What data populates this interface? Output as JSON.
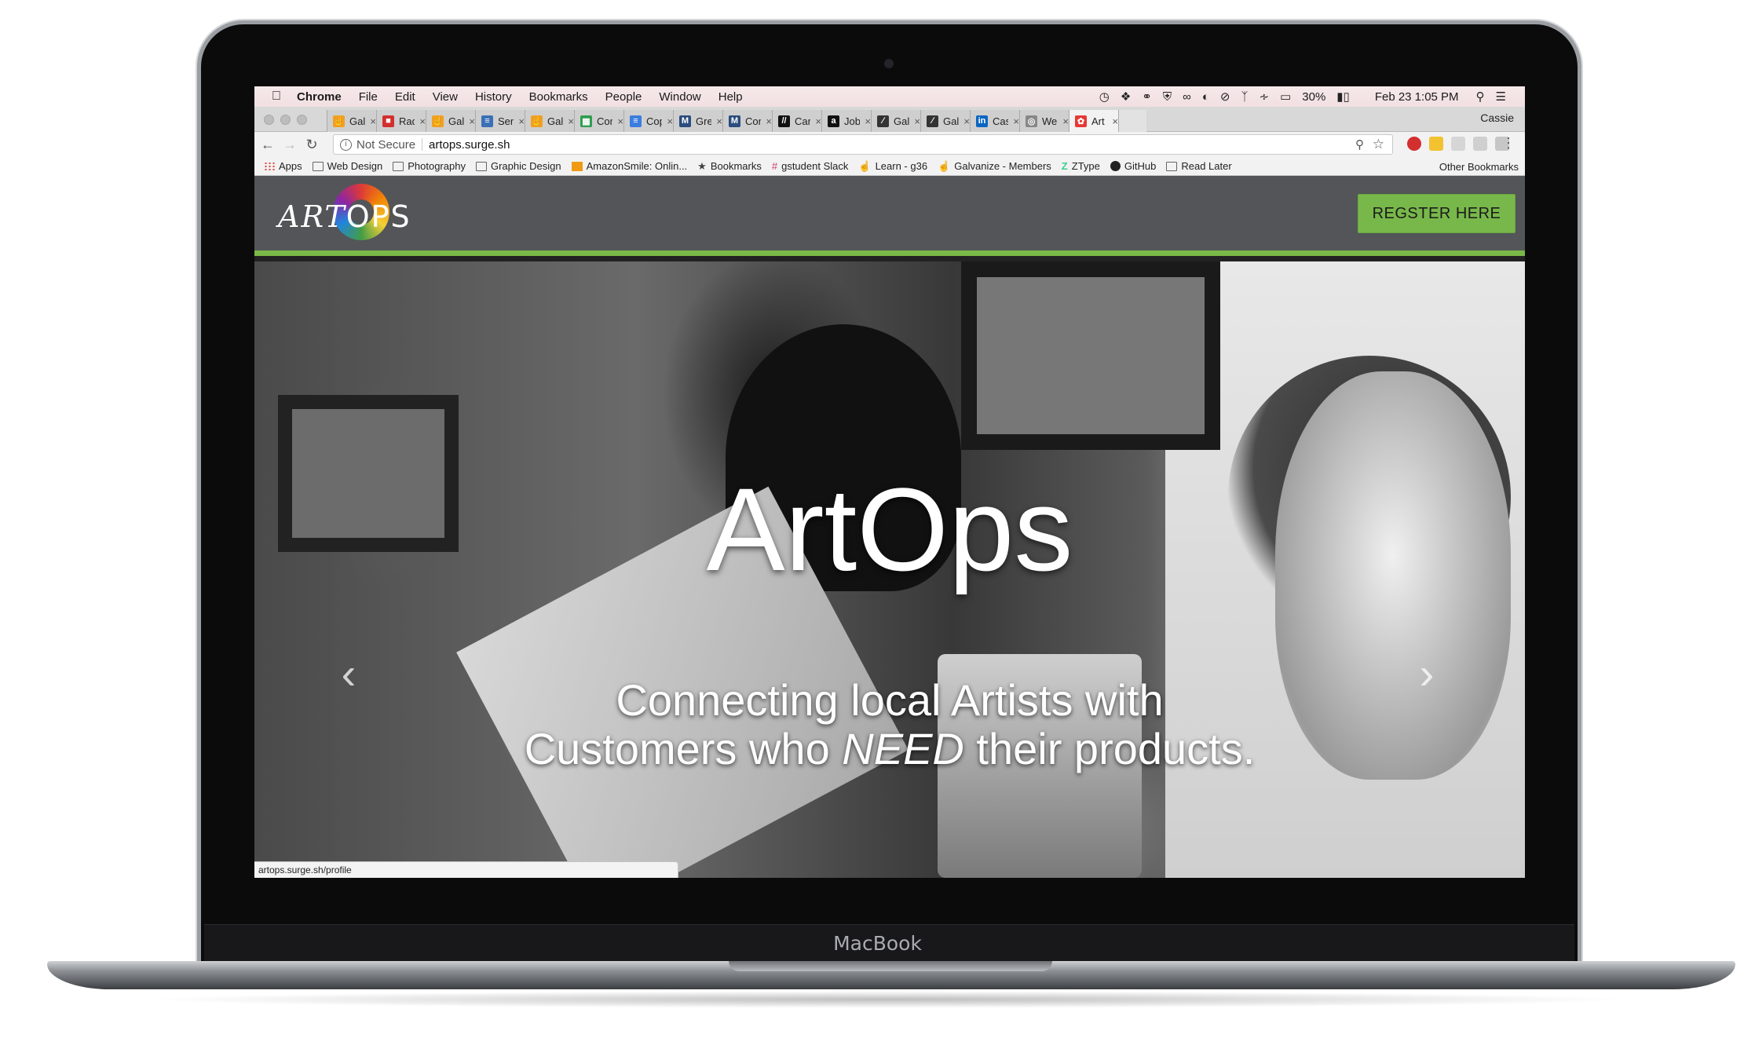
{
  "device": {
    "brand": "MacBook"
  },
  "menubar": {
    "app": "Chrome",
    "items": [
      "File",
      "Edit",
      "View",
      "History",
      "Bookmarks",
      "People",
      "Window",
      "Help"
    ],
    "battery": "30%",
    "datetime": "Feb 23  1:05 PM"
  },
  "tabs": [
    {
      "title": "Galv",
      "icon_color": "#f0a020",
      "icon": "hand-icon"
    },
    {
      "title": "Radi",
      "icon_color": "#d32f2f",
      "icon": "radio-icon"
    },
    {
      "title": "Galv",
      "icon_color": "#f0a020",
      "icon": "hand-icon"
    },
    {
      "title": "Seni",
      "icon_color": "#3b6fb6",
      "icon": "doc-icon"
    },
    {
      "title": "Galv",
      "icon_color": "#f0a020",
      "icon": "hand-icon"
    },
    {
      "title": "Com",
      "icon_color": "#2e9d4f",
      "icon": "sheets-icon"
    },
    {
      "title": "Cop",
      "icon_color": "#3b7de0",
      "icon": "docs-icon"
    },
    {
      "title": "Gree",
      "icon_color": "#2b4c7e",
      "icon": "m-icon"
    },
    {
      "title": "Cont",
      "icon_color": "#2b4c7e",
      "icon": "m-icon"
    },
    {
      "title": "Care",
      "icon_color": "#111111",
      "icon": "career-icon"
    },
    {
      "title": "Job",
      "icon_color": "#111111",
      "icon": "amazon-icon"
    },
    {
      "title": "Galv",
      "icon_color": "#333333",
      "icon": "pen-icon"
    },
    {
      "title": "Galv",
      "icon_color": "#333333",
      "icon": "pen-icon"
    },
    {
      "title": "Cass",
      "icon_color": "#0a66c2",
      "icon": "linkedin-icon"
    },
    {
      "title": "Web",
      "icon_color": "#888888",
      "icon": "globe-icon"
    },
    {
      "title": "Art",
      "icon_color": "#e53935",
      "icon": "artops-icon",
      "active": true
    }
  ],
  "profile": "Cassie",
  "address": {
    "security": "Not Secure",
    "url": "artops.surge.sh"
  },
  "bookmarks": [
    {
      "label": "Apps",
      "icon": "apps-icon"
    },
    {
      "label": "Web Design",
      "icon": "folder-icon"
    },
    {
      "label": "Photography",
      "icon": "folder-icon"
    },
    {
      "label": "Graphic Design",
      "icon": "folder-icon"
    },
    {
      "label": "AmazonSmile: Onlin...",
      "icon": "amazon-icon"
    },
    {
      "label": "Bookmarks",
      "icon": "star-icon"
    },
    {
      "label": "gstudent Slack",
      "icon": "slack-icon"
    },
    {
      "label": "Learn - g36",
      "icon": "hand-icon"
    },
    {
      "label": "Galvanize - Members",
      "icon": "hand-icon"
    },
    {
      "label": "ZType",
      "icon": "ztype-icon"
    },
    {
      "label": "GitHub",
      "icon": "github-icon"
    },
    {
      "label": "Read Later",
      "icon": "folder-icon"
    }
  ],
  "other_bookmarks": "Other Bookmarks",
  "site": {
    "logo": {
      "part1": "ART",
      "part2": "OPS"
    },
    "register_button": "REGSTER HERE",
    "hero": {
      "title": "ArtOps",
      "subtitle_line1": "Connecting local Artists with",
      "subtitle_line2_pre": "Customers who ",
      "subtitle_line2_em": "NEED",
      "subtitle_line2_post": " their products."
    },
    "prev_arrow": "‹",
    "next_arrow": "›"
  },
  "status_url": "artops.surge.sh/profile",
  "colors": {
    "nav_bg": "#535558",
    "accent_green": "#78b84a",
    "menubar_bg": "#f4e4e5"
  }
}
